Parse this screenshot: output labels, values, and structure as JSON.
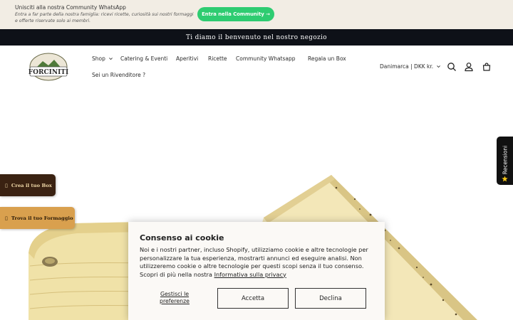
{
  "promo": {
    "title": "Unisciti alla nostra Community WhatsApp",
    "subtitle": "Entra a far parte della nostra famiglia: ricevi ricette, curiosità sui nostri formaggi e offerte riservate solo ai membri.",
    "button_label": "Entra nella Community →",
    "accent_color": "#2ecc71"
  },
  "announcement": {
    "text": "Ti diamo il benvenuto nel nostro negozio"
  },
  "header": {
    "logo_text": "FORCINITI",
    "nav": [
      {
        "label": "Shop",
        "has_dropdown": true
      },
      {
        "label": "Catering & Eventi"
      },
      {
        "label": "Aperitivi"
      },
      {
        "label": "Ricette"
      },
      {
        "label": "Community Whatsapp"
      },
      {
        "label": "Regala un Box"
      },
      {
        "label": "Sei un Rivenditore ?"
      }
    ],
    "locale_selector": "Danimarca | DKK kr.",
    "icons": [
      "search-icon",
      "account-icon",
      "cart-icon"
    ]
  },
  "side_buttons": {
    "box_label": "Crea il tuo Box",
    "cheese_label": "Trova il tuo Formaggio"
  },
  "reviews_tab": {
    "label": "Recensioni"
  },
  "cookie": {
    "title": "Consenso ai cookie",
    "body": "Noi e i nostri partner, incluso Shopify, utilizziamo cookie e altre tecnologie per personalizzare la tua esperienza, mostrarti annunci ed eseguire analisi. Non utilizzeremo cookie o altre tecnologie per questi scopi senza il tuo consenso. Scopri di più nella nostra",
    "privacy_link": "Informativa sulla privacy",
    "manage_label": "Gestisci le preferenze",
    "accept_label": "Accetta",
    "decline_label": "Declina"
  }
}
